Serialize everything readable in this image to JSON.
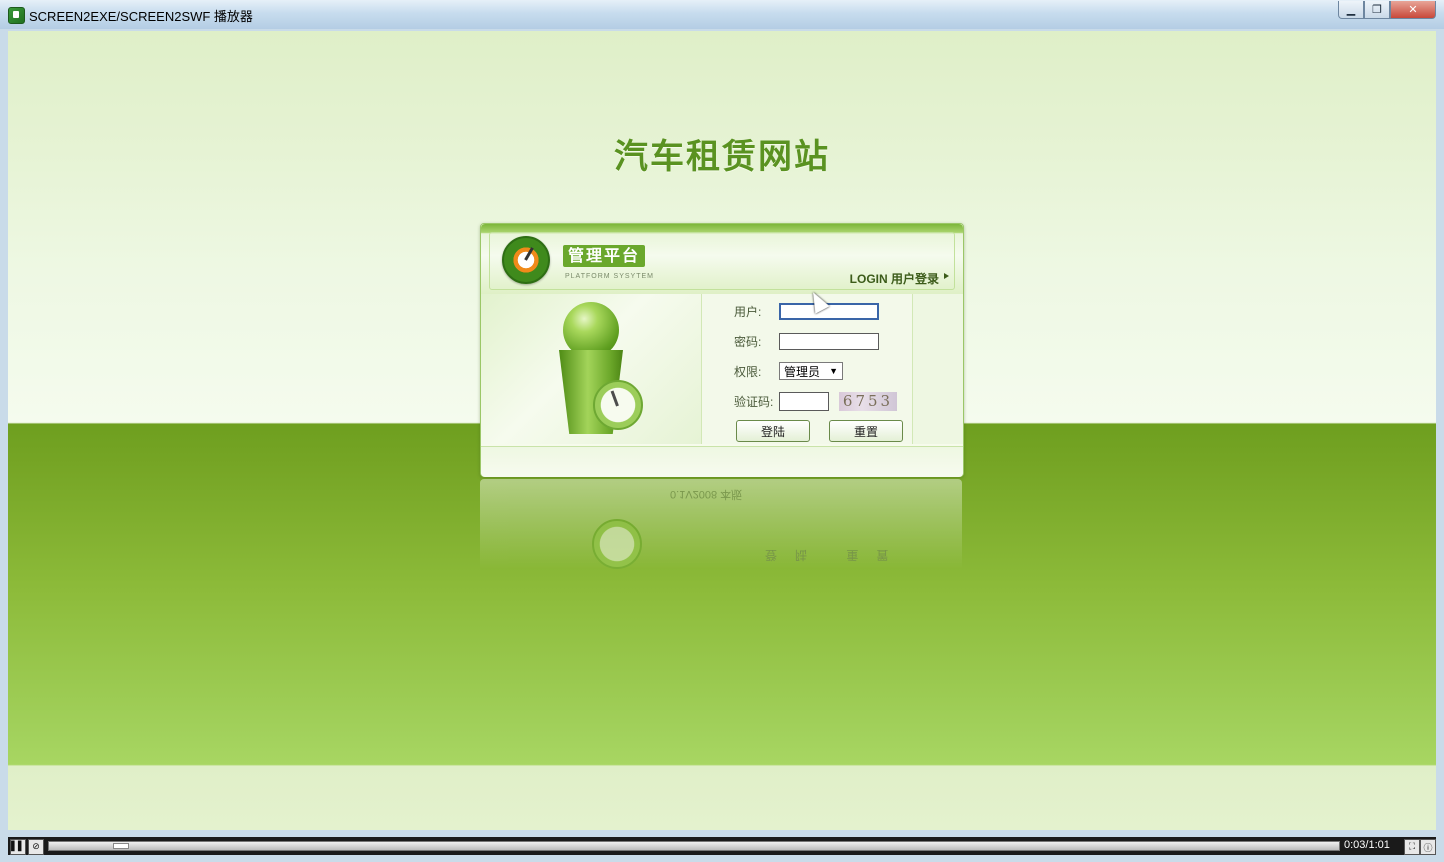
{
  "window": {
    "title": "SCREEN2EXE/SCREEN2SWF 播放器",
    "minimize_label": "▁",
    "maximize_label": "❐",
    "close_label": "✕"
  },
  "page": {
    "site_title": "汽车租赁网站"
  },
  "login": {
    "platform_badge": "管理平台",
    "platform_sub": "PLATFORM SYSYTEM",
    "login_label": "LOGIN 用户登录",
    "user_label": "用户:",
    "password_label": "密码:",
    "role_label": "权限:",
    "role_selected": "管理员",
    "captcha_label": "验证码:",
    "captcha_value": "6753",
    "login_button": "登陆",
    "reset_button": "重置"
  },
  "reflection": {
    "version_text": "0.1V2008 本版",
    "buttons_text": "登陆 重置"
  },
  "player": {
    "pause_icon": "pause-icon",
    "stop_icon": "stop-icon",
    "progress": 0.05,
    "time": "0:03/1:01"
  }
}
